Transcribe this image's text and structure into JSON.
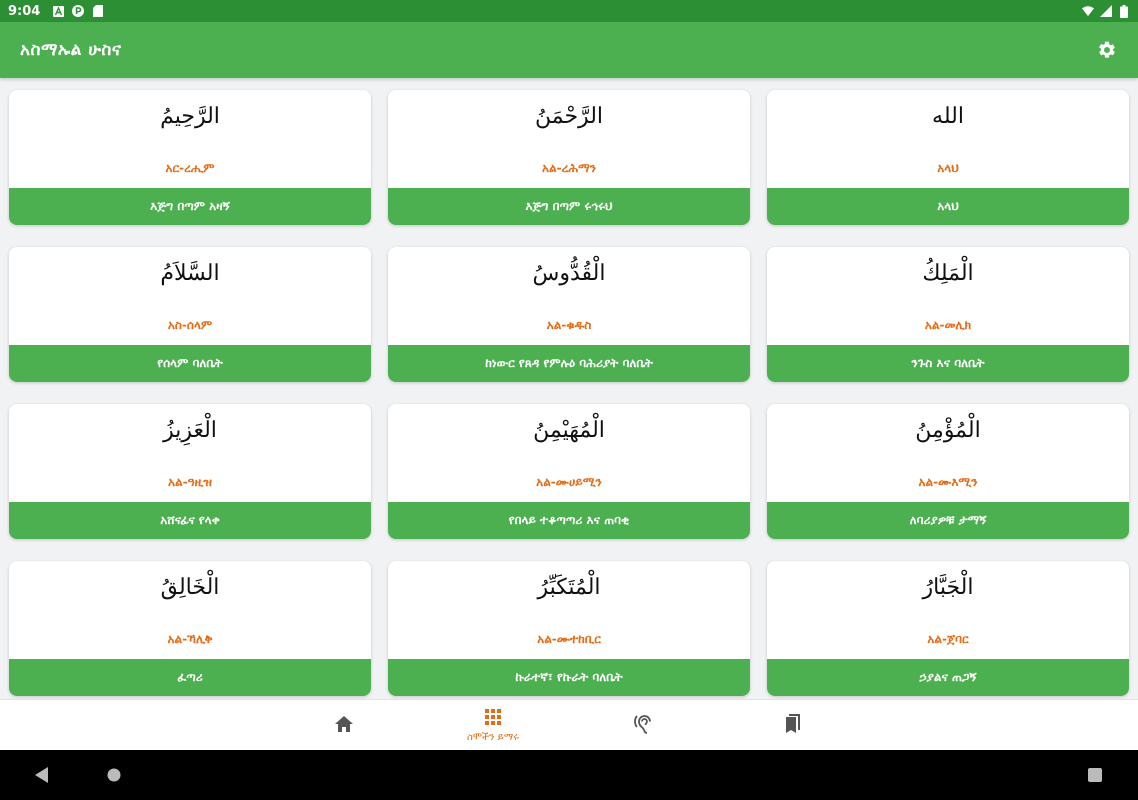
{
  "status_bar": {
    "time": "9:04",
    "icons": [
      "a-icon",
      "p-icon",
      "sdcard-icon",
      "wifi-icon",
      "signal-icon",
      "battery-icon"
    ]
  },
  "app_bar": {
    "title": "አስማኡል ሁስና",
    "settings_icon": "gear-icon"
  },
  "colors": {
    "primary": "#4cb050",
    "status_bar": "#2d8f33",
    "accent": "#e56b14",
    "background": "#f0f2f3"
  },
  "names": [
    {
      "arabic": "الرَّحِيمُ",
      "translit": "አር-ረሒም",
      "meaning": "እጅግ በጣም አዛኝ"
    },
    {
      "arabic": "الرَّحْمَنُ",
      "translit": "አል-ረሕማን",
      "meaning": "እጅግ በጣም ሩኅሩህ"
    },
    {
      "arabic": "الله",
      "translit": "አላህ",
      "meaning": "አላህ"
    },
    {
      "arabic": "السَّلاَمُ",
      "translit": "አስ-ሰላም",
      "meaning": "የሰላም ባለቤት"
    },
    {
      "arabic": "الْقُدُّوسُ",
      "translit": "አል-ቁዱስ",
      "meaning": "ከነውር የጸዳ የምሉዕ ባሕሪያት ባለቤት"
    },
    {
      "arabic": "الْمَلِكُ",
      "translit": "አል-መሊክ",
      "meaning": "ንጉስ እና ባለቤት"
    },
    {
      "arabic": "الْعَزِيزُ",
      "translit": "አል-ዓዚዝ",
      "meaning": "አሸናፊና የላቀ"
    },
    {
      "arabic": "الْمُهَيْمِنُ",
      "translit": "አል-ሙሀይሚን",
      "meaning": "የበላይ ተቆጣጣሪ እና ጠባቂ"
    },
    {
      "arabic": "الْمُؤْمِنُ",
      "translit": "አል-ሙእሚን",
      "meaning": "ለባሪያዎቹ ታማኝ"
    },
    {
      "arabic": "الْخَالِقُ",
      "translit": "አል-ኻሊቅ",
      "meaning": "ፈጣሪ"
    },
    {
      "arabic": "الْمُتَكَبِّرُ",
      "translit": "አል-ሙተከቢር",
      "meaning": "ኩራተኛ፣ የኩራት ባለቤት"
    },
    {
      "arabic": "الْجَبَّارُ",
      "translit": "አል-ጀባር",
      "meaning": "ኃያልና ጠጋኝ"
    }
  ],
  "bottom_nav": {
    "items": [
      {
        "icon": "home-icon",
        "label": "",
        "active": false
      },
      {
        "icon": "grid-icon",
        "label": "ስሞችን ይማሩ",
        "active": true
      },
      {
        "icon": "hearing-icon",
        "label": "",
        "active": false
      },
      {
        "icon": "bookmarks-icon",
        "label": "",
        "active": false
      }
    ]
  },
  "system_nav": [
    "back-icon",
    "home-circle-icon",
    "recents-icon"
  ]
}
